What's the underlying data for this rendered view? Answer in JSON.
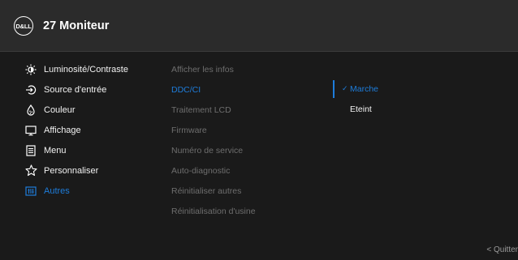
{
  "header": {
    "logo_text": "D&LL",
    "title": "27 Moniteur"
  },
  "menu": [
    {
      "label": "Luminosité/Contraste",
      "icon": "brightness-icon"
    },
    {
      "label": "Source d'entrée",
      "icon": "input-source-icon"
    },
    {
      "label": "Couleur",
      "icon": "color-palette-icon"
    },
    {
      "label": "Affichage",
      "icon": "display-icon"
    },
    {
      "label": "Menu",
      "icon": "menu-document-icon"
    },
    {
      "label": "Personnaliser",
      "icon": "star-icon"
    },
    {
      "label": "Autres",
      "icon": "others-icon",
      "active": true
    }
  ],
  "submenu": [
    "Afficher les infos",
    "DDC/CI",
    "Traitement LCD",
    "Firmware",
    "Numéro de service",
    "Auto-diagnostic",
    "Réinitialiser autres",
    "Réinitialisation d'usine"
  ],
  "options": [
    {
      "label": "Marche",
      "check": "✓",
      "selected": true
    },
    {
      "label": "Eteint",
      "selected": false
    }
  ],
  "footer": {
    "quit_label": "< Quitter"
  },
  "colors": {
    "accent": "#1e7ddb",
    "header_bg": "#2b2b2b",
    "body_bg": "#1a1a1a",
    "muted_text": "#6e6e6e"
  }
}
